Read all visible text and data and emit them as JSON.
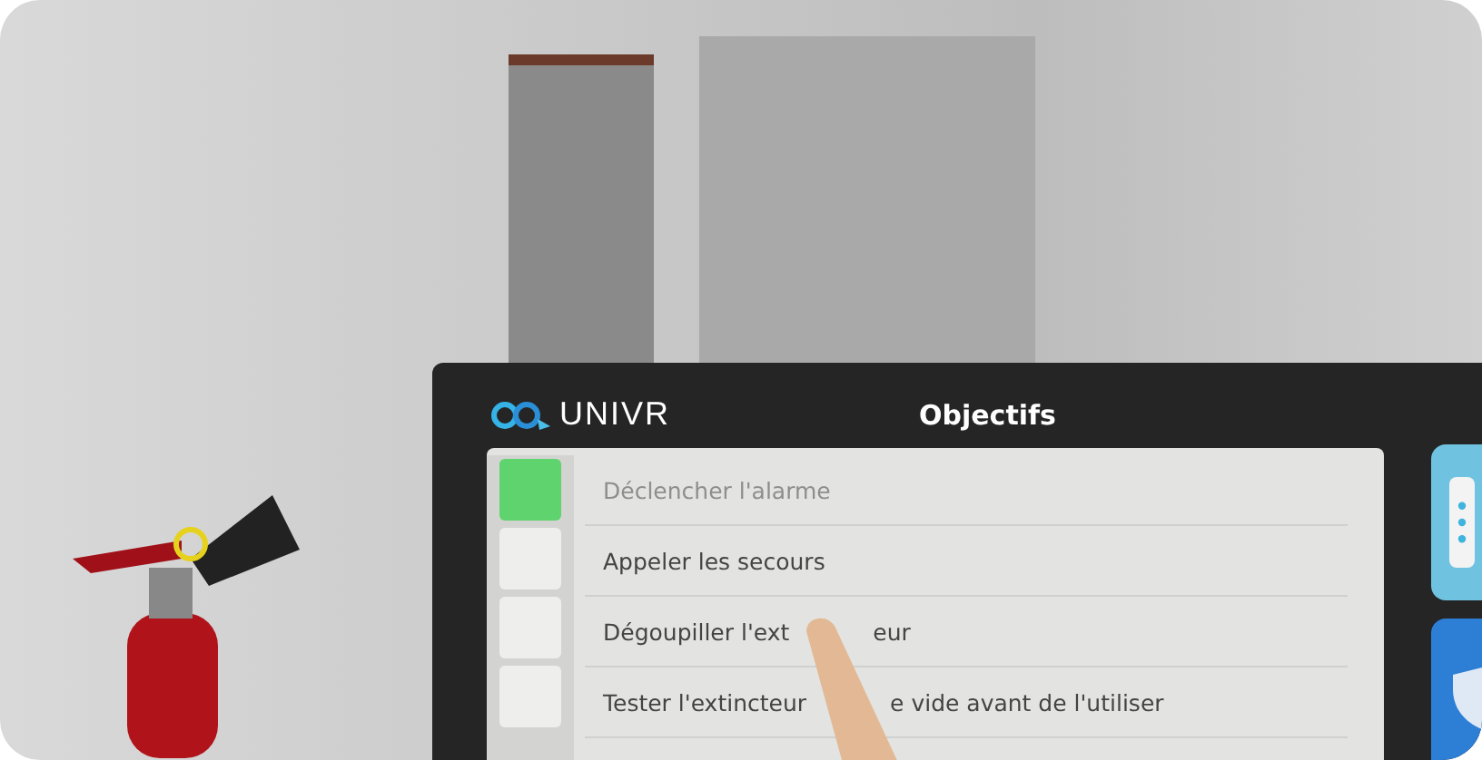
{
  "panel": {
    "logo": "UNIVR",
    "title": "Objectifs",
    "objectives": [
      {
        "parts": [
          "Déclencher l'alarme"
        ],
        "checked": true
      },
      {
        "parts": [
          "Appeler les secours"
        ],
        "checked": false
      },
      {
        "parts": [
          "Dégoupiller l'ext",
          "eur"
        ],
        "checked": false
      },
      {
        "parts": [
          "Tester l'extincteur",
          "e vide avant de l'utiliser"
        ],
        "checked": false
      }
    ]
  }
}
